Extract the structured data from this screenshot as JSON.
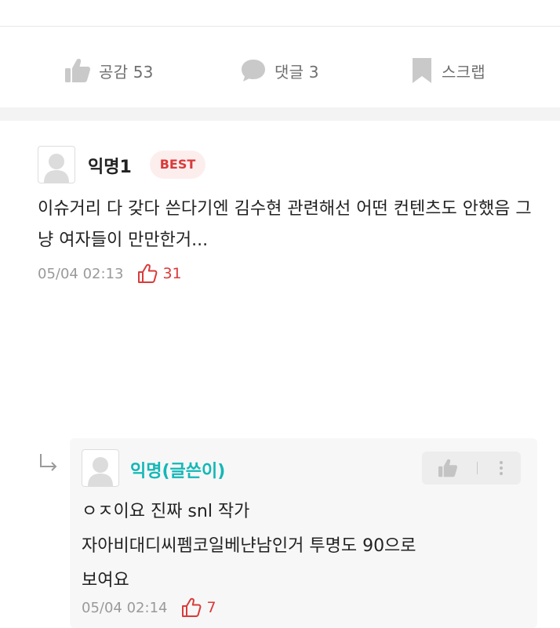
{
  "colors": {
    "accent_red": "#d93b3b",
    "author_teal": "#14b7b7",
    "muted": "#9a9a9a"
  },
  "actions": {
    "like": {
      "icon": "thumbs-up-icon",
      "label": "공감 53"
    },
    "comment": {
      "icon": "speech-bubble-icon",
      "label": "댓글 3"
    },
    "scrap": {
      "icon": "bookmark-icon",
      "label": "스크랩"
    }
  },
  "comments": [
    {
      "author": "익명1",
      "badge": "BEST",
      "text": "이슈거리 다 갖다 쓴다기엔 김수현 관련해선 어떤 컨텐츠도 안했음 그냥 여자들이 만만한거...",
      "date": "05/04 02:13",
      "likes": "31"
    }
  ],
  "reply": {
    "author": "익명(글쓴이)",
    "lines": [
      "ㅇㅈ이요 진짜 snl 작가",
      "자아비대디씨펨코일베냔남인거 투명도 90으로",
      "보여요"
    ],
    "date": "05/04 02:14",
    "likes": "7"
  }
}
